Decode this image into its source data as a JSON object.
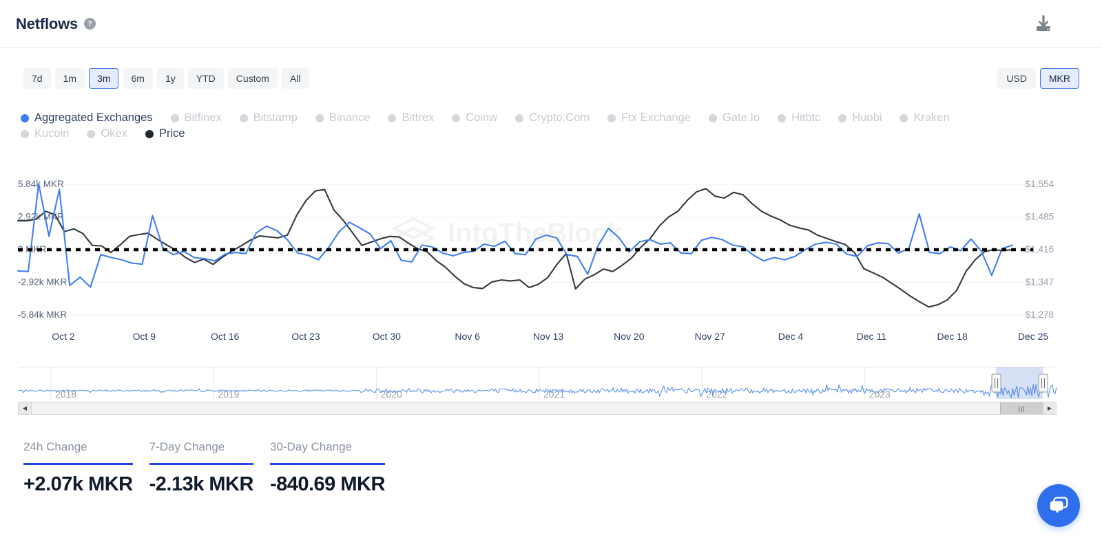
{
  "header": {
    "title": "Netflows",
    "help_icon": "question-circle-icon",
    "download_icon": "download-icon"
  },
  "toolbar": {
    "ranges": [
      {
        "label": "7d",
        "active": false
      },
      {
        "label": "1m",
        "active": false
      },
      {
        "label": "3m",
        "active": true
      },
      {
        "label": "6m",
        "active": false
      },
      {
        "label": "1y",
        "active": false
      },
      {
        "label": "YTD",
        "active": false
      },
      {
        "label": "Custom",
        "active": false
      },
      {
        "label": "All",
        "active": false
      }
    ],
    "currencies": [
      {
        "label": "USD",
        "active": false
      },
      {
        "label": "MKR",
        "active": true
      }
    ]
  },
  "legend": [
    {
      "label": "Aggregated Exchanges",
      "on": true,
      "color": "#3f7ff0"
    },
    {
      "label": "Bitfinex",
      "on": false,
      "color": "#d4d7dc"
    },
    {
      "label": "Bitstamp",
      "on": false,
      "color": "#d4d7dc"
    },
    {
      "label": "Binance",
      "on": false,
      "color": "#d4d7dc"
    },
    {
      "label": "Bittrex",
      "on": false,
      "color": "#d4d7dc"
    },
    {
      "label": "Coinw",
      "on": false,
      "color": "#d4d7dc"
    },
    {
      "label": "Crypto.Com",
      "on": false,
      "color": "#d4d7dc"
    },
    {
      "label": "Ftx Exchange",
      "on": false,
      "color": "#d4d7dc"
    },
    {
      "label": "Gate.Io",
      "on": false,
      "color": "#d4d7dc"
    },
    {
      "label": "Hitbtc",
      "on": false,
      "color": "#d4d7dc"
    },
    {
      "label": "Huobi",
      "on": false,
      "color": "#d4d7dc"
    },
    {
      "label": "Kraken",
      "on": false,
      "color": "#d4d7dc"
    },
    {
      "label": "Kucoin",
      "on": false,
      "color": "#d4d7dc"
    },
    {
      "label": "Okex",
      "on": false,
      "color": "#d4d7dc"
    },
    {
      "label": "Price",
      "on": true,
      "color": "#222831"
    }
  ],
  "watermark": "IntoTheBlock",
  "navigator": {
    "years": [
      "2018",
      "2019",
      "2020",
      "2021",
      "2022",
      "2023"
    ],
    "scrollbar": {
      "left_arrow": "left-arrow-icon",
      "right_arrow": "right-arrow-icon",
      "thumb_grip": "|||"
    }
  },
  "stats": [
    {
      "label": "24h Change",
      "value": "+2.07k MKR"
    },
    {
      "label": "7-Day Change",
      "value": "-2.13k MKR"
    },
    {
      "label": "30-Day Change",
      "value": "-840.69 MKR"
    }
  ],
  "chat": {
    "icon": "chat-bubble-icon"
  },
  "colors": {
    "netflow_line": "#3f7ff0",
    "price_line": "#33393f",
    "zero_line": "#000000",
    "accent": "#2747e0",
    "active_btn_bg": "#e4ecfd",
    "active_btn_border": "#3f6fe8"
  },
  "chart_data": {
    "type": "line",
    "title": "Netflows",
    "xlabel": "",
    "ylabel": "MKR",
    "y_left_ticks": [
      "5.84k MKR",
      "2.92k MKR",
      "0 MKR",
      "-2.92k MKR",
      "-5.84k MKR"
    ],
    "y_left_values": [
      5840,
      2920,
      0,
      -2920,
      -5840
    ],
    "y_right_ticks": [
      "$1,554",
      "$1,485",
      "$1,416",
      "$1,347",
      "$1,278"
    ],
    "y_right_values": [
      1554,
      1485,
      1416,
      1347,
      1278
    ],
    "ylim_left": [
      -7300,
      7300
    ],
    "ylim_right": [
      1243.5,
      1588.5
    ],
    "x_ticks": [
      "Oct 2",
      "Oct 9",
      "Oct 16",
      "Oct 23",
      "Oct 30",
      "Nov 6",
      "Nov 13",
      "Nov 20",
      "Nov 27",
      "Dec 4",
      "Dec 11",
      "Dec 18",
      "Dec 25"
    ],
    "grid": true,
    "legend_position": "top",
    "zero_line": 0,
    "series": [
      {
        "name": "Aggregated Exchanges",
        "color": "#3f7ff0",
        "unit": "MKR",
        "values": [
          -1900,
          -1950,
          5900,
          1200,
          5400,
          -3200,
          -2450,
          -3350,
          -450,
          -700,
          -900,
          -1200,
          -1300,
          3050,
          150,
          -450,
          -150,
          -700,
          -800,
          -1000,
          -400,
          -250,
          -350,
          1500,
          2100,
          1700,
          900,
          -300,
          -500,
          -900,
          200,
          1600,
          2450,
          1950,
          1400,
          100,
          800,
          -950,
          -1100,
          400,
          250,
          -300,
          -550,
          -250,
          -150,
          500,
          300,
          750,
          -350,
          -450,
          950,
          1300,
          1050,
          -450,
          -600,
          -2200,
          350,
          1900,
          1100,
          -200,
          700,
          900,
          500,
          600,
          -300,
          -350,
          850,
          1100,
          900,
          400,
          250,
          -500,
          -1000,
          -700,
          -900,
          -600,
          0,
          500,
          650,
          500,
          -400,
          -600,
          350,
          600,
          550,
          -300,
          100,
          3200,
          -250,
          -350,
          250,
          -100,
          950,
          -150,
          -2300,
          100,
          400
        ]
      },
      {
        "name": "Price",
        "color": "#33393f",
        "unit": "USD",
        "values": [
          1477,
          1477,
          1481,
          1497,
          1490,
          1454,
          1460,
          1450,
          1425,
          1424,
          1410,
          1426,
          1444,
          1448,
          1451,
          1438,
          1426,
          1415,
          1400,
          1389,
          1396,
          1385,
          1400,
          1413,
          1424,
          1436,
          1445,
          1443,
          1441,
          1447,
          1489,
          1520,
          1540,
          1543,
          1500,
          1478,
          1452,
          1425,
          1432,
          1439,
          1444,
          1443,
          1430,
          1418,
          1412,
          1393,
          1379,
          1360,
          1344,
          1336,
          1334,
          1348,
          1352,
          1350,
          1352,
          1336,
          1343,
          1357,
          1385,
          1408,
          1333,
          1354,
          1363,
          1375,
          1370,
          1383,
          1398,
          1421,
          1439,
          1466,
          1485,
          1497,
          1520,
          1538,
          1545,
          1529,
          1525,
          1537,
          1532,
          1513,
          1497,
          1487,
          1479,
          1468,
          1462,
          1458,
          1447,
          1440,
          1433,
          1427,
          1410,
          1376,
          1367,
          1358,
          1345,
          1332,
          1318,
          1306,
          1295,
          1300,
          1310,
          1330,
          1370,
          1395,
          1412,
          1416,
          1414,
          1416
        ]
      }
    ],
    "navigator_series": {
      "name": "Aggregated Exchanges",
      "color": "#3f7ff0",
      "year_marks": [
        "2018",
        "2019",
        "2020",
        "2021",
        "2022",
        "2023"
      ]
    }
  }
}
